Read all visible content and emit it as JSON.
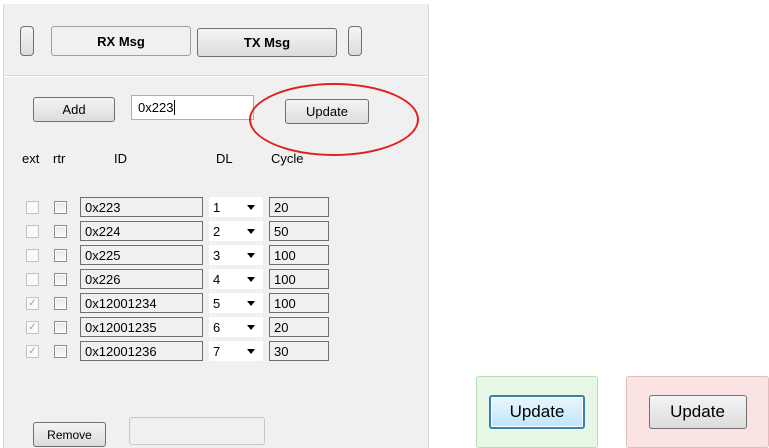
{
  "tabs": {
    "rx_label": "RX Msg",
    "tx_label": "TX Msg"
  },
  "toolbar": {
    "add_label": "Add",
    "id_input_value": "0x223",
    "update_label": "Update"
  },
  "columns": {
    "ext": "ext",
    "rtr": "rtr",
    "id": "ID",
    "dl": "DL",
    "cycle": "Cycle"
  },
  "rows": [
    {
      "ext": false,
      "rtr": false,
      "id": "0x223",
      "dl": "1",
      "cycle": "20"
    },
    {
      "ext": false,
      "rtr": false,
      "id": "0x224",
      "dl": "2",
      "cycle": "50"
    },
    {
      "ext": false,
      "rtr": false,
      "id": "0x225",
      "dl": "3",
      "cycle": "100"
    },
    {
      "ext": false,
      "rtr": false,
      "id": "0x226",
      "dl": "4",
      "cycle": "100"
    },
    {
      "ext": true,
      "rtr": false,
      "id": "0x12001234",
      "dl": "5",
      "cycle": "100"
    },
    {
      "ext": true,
      "rtr": false,
      "id": "0x12001235",
      "dl": "6",
      "cycle": "20"
    },
    {
      "ext": true,
      "rtr": false,
      "id": "0x12001236",
      "dl": "7",
      "cycle": "30"
    }
  ],
  "footer": {
    "remove_label": "Remove"
  },
  "examples": {
    "focused_update_label": "Update",
    "normal_update_label": "Update"
  },
  "colors": {
    "highlight_circle": "#e02020",
    "focus_frame_bg": "#e6f7e6",
    "normal_frame_bg": "#fbe3e3",
    "focus_button_border": "#3c7fb1"
  }
}
